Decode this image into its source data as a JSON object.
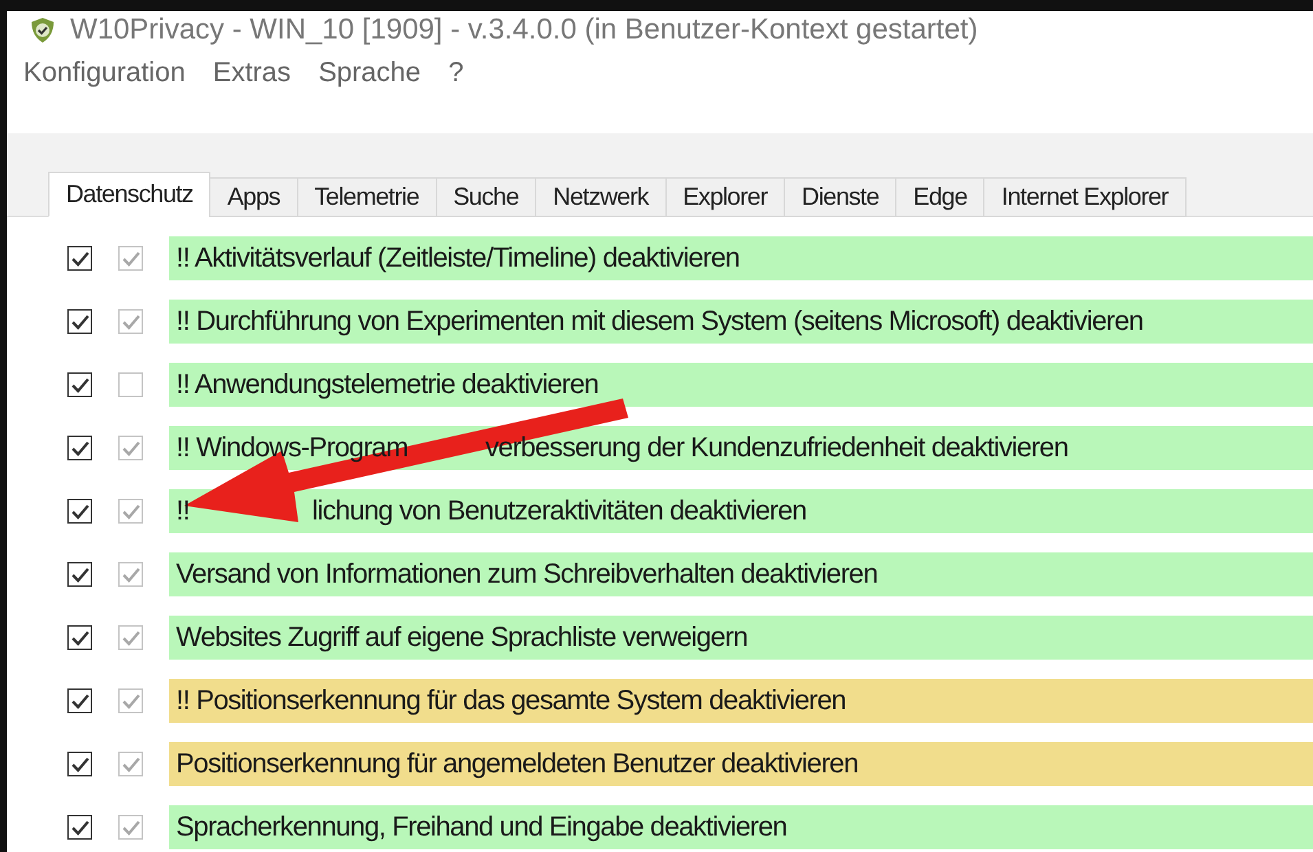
{
  "window": {
    "title": "W10Privacy - WIN_10 [1909]  - v.3.4.0.0 (in Benutzer-Kontext gestartet)"
  },
  "menu": [
    "Konfiguration",
    "Extras",
    "Sprache",
    "?"
  ],
  "tabs": [
    {
      "label": "Datenschutz",
      "selected": true
    },
    {
      "label": "Apps",
      "selected": false
    },
    {
      "label": "Telemetrie",
      "selected": false
    },
    {
      "label": "Suche",
      "selected": false
    },
    {
      "label": "Netzwerk",
      "selected": false
    },
    {
      "label": "Explorer",
      "selected": false
    },
    {
      "label": "Dienste",
      "selected": false
    },
    {
      "label": "Edge",
      "selected": false
    },
    {
      "label": "Internet Explorer",
      "selected": false
    }
  ],
  "settings": [
    {
      "parts": [
        "!! Aktivitätsverlauf (Zeitleiste/Timeline) deaktivieren"
      ],
      "checked": true,
      "recommended": true,
      "color": "#b9f7b9"
    },
    {
      "parts": [
        "!! Durchführung von Experimenten mit diesem System (seitens Microsoft) deaktivieren"
      ],
      "checked": true,
      "recommended": true,
      "color": "#b9f7b9"
    },
    {
      "parts": [
        "!! Anwendungstelemetrie deaktivieren"
      ],
      "checked": true,
      "recommended": false,
      "color": "#b9f7b9"
    },
    {
      "parts": [
        "!! Windows-Program",
        "verbesserung der Kundenzufriedenheit deaktivieren"
      ],
      "checked": true,
      "recommended": true,
      "color": "#b9f7b9"
    },
    {
      "parts": [
        "!!",
        "lichung von Benutzeraktivitäten deaktivieren"
      ],
      "checked": true,
      "recommended": true,
      "color": "#b9f7b9"
    },
    {
      "parts": [
        "Versand von Informationen zum Schreibverhalten deaktivieren"
      ],
      "checked": true,
      "recommended": true,
      "color": "#b9f7b9"
    },
    {
      "parts": [
        "Websites Zugriff auf eigene Sprachliste verweigern"
      ],
      "checked": true,
      "recommended": true,
      "color": "#b9f7b9"
    },
    {
      "parts": [
        "!! Positionserkennung für das gesamte System deaktivieren"
      ],
      "checked": true,
      "recommended": true,
      "color": "#f1dd8c"
    },
    {
      "parts": [
        "Positionserkennung für angemeldeten Benutzer deaktivieren"
      ],
      "checked": true,
      "recommended": true,
      "color": "#f1dd8c"
    },
    {
      "parts": [
        "Spracherkennung, Freihand und Eingabe deaktivieren"
      ],
      "checked": true,
      "recommended": true,
      "color": "#b9f7b9"
    }
  ]
}
